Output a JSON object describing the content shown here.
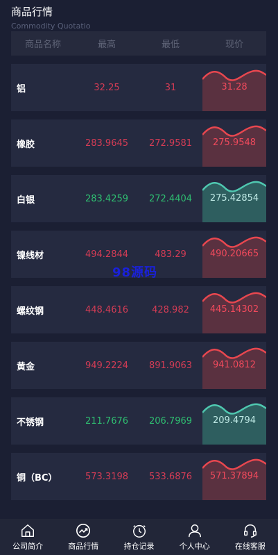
{
  "header": {
    "title": "商品行情",
    "subtitle": "Commodity Quotatio"
  },
  "columns": [
    "商品名称",
    "最高",
    "最低",
    "现价"
  ],
  "items": [
    {
      "name": "铝",
      "high": "32.25",
      "low": "31",
      "now": "31.28",
      "trend": "up"
    },
    {
      "name": "橡胶",
      "high": "283.9645",
      "low": "272.9581",
      "now": "275.9548",
      "trend": "up"
    },
    {
      "name": "白银",
      "high": "283.4259",
      "low": "272.4404",
      "now": "275.42854",
      "trend": "down"
    },
    {
      "name": "镍线材",
      "high": "494.2844",
      "low": "483.29",
      "now": "490.20665",
      "trend": "up"
    },
    {
      "name": "螺纹钢",
      "high": "448.4616",
      "low": "428.982",
      "now": "445.14302",
      "trend": "up"
    },
    {
      "name": "黄金",
      "high": "949.2224",
      "low": "891.9063",
      "now": "941.0812",
      "trend": "up"
    },
    {
      "name": "不锈钢",
      "high": "211.7676",
      "low": "206.7969",
      "now": "209.4794",
      "trend": "down"
    },
    {
      "name": "铜（BC）",
      "high": "573.3198",
      "low": "533.6876",
      "now": "571.37894",
      "trend": "up"
    }
  ],
  "watermark": "98源码",
  "tabs": [
    {
      "label": "公司简介",
      "icon": "home-icon"
    },
    {
      "label": "商品行情",
      "icon": "trend-icon"
    },
    {
      "label": "持仓记录",
      "icon": "clock-icon"
    },
    {
      "label": "个人中心",
      "icon": "user-icon"
    },
    {
      "label": "在线客服",
      "icon": "headset-icon"
    }
  ],
  "colors": {
    "up": "#d43c55",
    "down": "#2fbf71",
    "background": "#1b1f33",
    "row": "#252a40"
  }
}
